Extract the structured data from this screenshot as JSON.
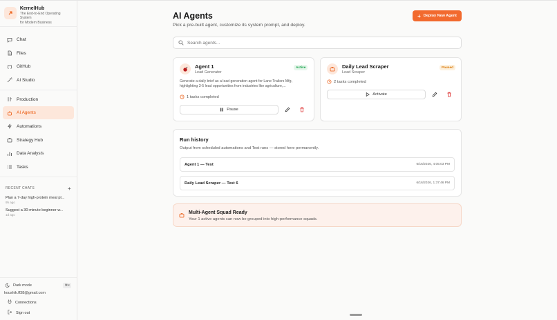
{
  "brand": {
    "name": "KernelHub",
    "tagline_1": "The End-to-End Operating System",
    "tagline_2": "for Modern Business"
  },
  "nav": {
    "top": [
      {
        "label": "Chat",
        "icon": "chat-icon"
      },
      {
        "label": "Files",
        "icon": "file-icon"
      },
      {
        "label": "GitHub",
        "icon": "github-icon"
      },
      {
        "label": "AI Studio",
        "icon": "wand-icon"
      }
    ],
    "main": [
      {
        "label": "Production",
        "icon": "production-icon"
      },
      {
        "label": "AI Agents",
        "icon": "bot-icon",
        "active": true
      },
      {
        "label": "Automations",
        "icon": "bolt-icon"
      },
      {
        "label": "Strategy Hub",
        "icon": "briefcase-icon"
      },
      {
        "label": "Data Analysis",
        "icon": "bar-chart-icon"
      },
      {
        "label": "Tasks",
        "icon": "tasks-icon"
      }
    ]
  },
  "recent": {
    "heading": "RECENT CHATS",
    "items": [
      {
        "title": "Plan a 7-day high-protein meal pl...",
        "time": "9h ago"
      },
      {
        "title": "Suggest a 30-minute beginner w...",
        "time": "1d ago"
      }
    ]
  },
  "footer": {
    "dark_mode": "Dark mode",
    "shortcut": "⌘K",
    "email": "koushik.ff38@gmail.com",
    "connections": "Connections",
    "sign_out": "Sign out"
  },
  "header": {
    "title": "AI Agents",
    "subtitle": "Pick a pre-built agent, customize its system prompt, and deploy.",
    "deploy_label": "Deploy New Agent"
  },
  "search": {
    "placeholder": "Search agents..."
  },
  "agents": [
    {
      "name": "Agent 1",
      "role": "Lead Generator",
      "status": "Active",
      "desc_1": "Generate a daily brief as a lead generation agent for Lane Trailers Mfg,",
      "desc_2": "highlighting 3-5 lead opportunities from industries like agriculture,...",
      "tasks": "1 tasks completed",
      "action": "Pause"
    },
    {
      "name": "Daily Lead Scraper",
      "role": "Lead Scraper",
      "status": "Paused",
      "tasks": "2 tasks completed",
      "action": "Activate"
    }
  ],
  "run_history": {
    "title": "Run history",
    "subtitle": "Output from scheduled automations and Test runs — stored here permanently.",
    "rows": [
      {
        "name": "Agent 1 — Test",
        "time": "6/16/2026, 4:05:03 PM"
      },
      {
        "name": "Daily Lead Scraper — Test 6",
        "time": "6/16/2026, 1:37:46 PM"
      }
    ]
  },
  "squad": {
    "title": "Multi-Agent Squad Ready",
    "subtitle": "Your 1 active agents can now be grouped into high-performance squads."
  },
  "colors": {
    "accent": "#f26a2e",
    "active_green": "#16a34a",
    "paused_amber": "#d97706",
    "delete_red": "#dc2626"
  }
}
